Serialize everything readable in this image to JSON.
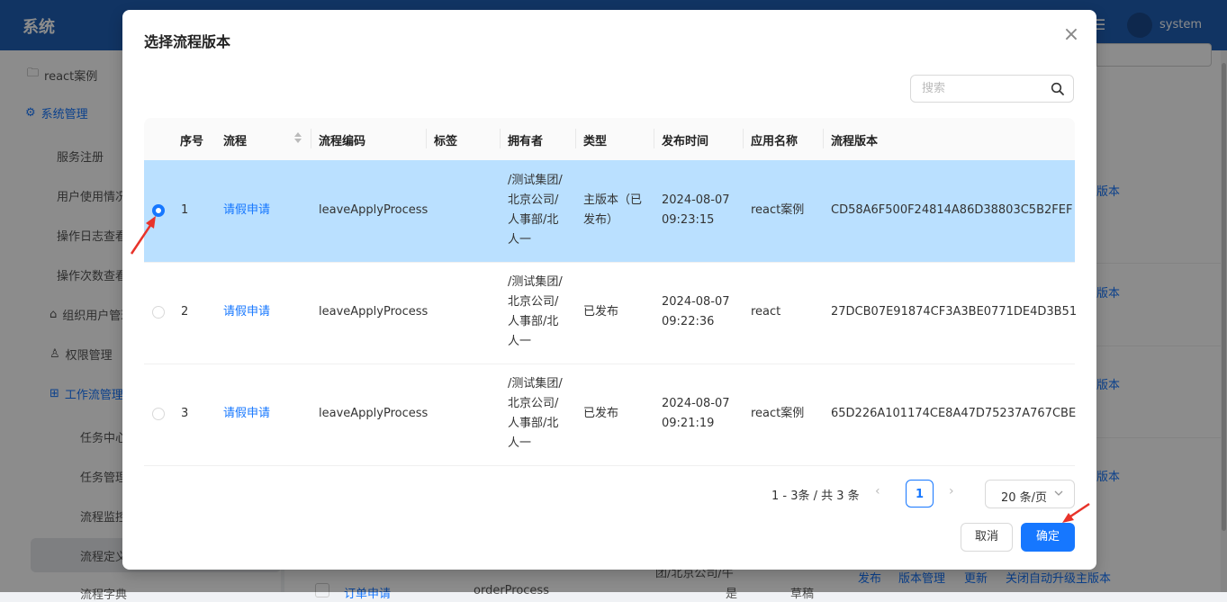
{
  "app": {
    "title": "系统",
    "user": "system"
  },
  "sidebar": {
    "items": [
      {
        "label": "react案例"
      },
      {
        "label": "系统管理"
      },
      {
        "label": "服务注册"
      },
      {
        "label": "用户使用情况"
      },
      {
        "label": "操作日志查看"
      },
      {
        "label": "操作次数查看"
      },
      {
        "label": "组织用户管理"
      },
      {
        "label": "权限管理"
      },
      {
        "label": "工作流管理"
      },
      {
        "label": "任务中心"
      },
      {
        "label": "任务管理"
      },
      {
        "label": "流程监控"
      },
      {
        "label": "流程定义"
      },
      {
        "label": "流程字典"
      }
    ]
  },
  "background": {
    "version_links": [
      "版本",
      "版本",
      "版本",
      "版本"
    ],
    "bottom_row": {
      "name": "订单申请",
      "code": "orderProcess",
      "owner": "团/北京公司/牛",
      "is_main": "是",
      "status": "草稿",
      "actions": [
        "发布",
        "版本管理",
        "更新",
        "关闭自动升级主版本"
      ]
    }
  },
  "modal": {
    "title": "选择流程版本",
    "close_label": "×",
    "search_placeholder": "搜索",
    "columns": {
      "index": "序号",
      "process": "流程",
      "code": "流程编码",
      "tag": "标签",
      "owner": "拥有者",
      "type": "类型",
      "publish_time": "发布时间",
      "app_name": "应用名称",
      "version": "流程版本"
    },
    "rows": [
      {
        "selected": true,
        "index": "1",
        "process": "请假申请",
        "code": "leaveApplyProcess",
        "tag": "",
        "owner_lines": [
          "/测试集团/",
          "北京公司/",
          "人事部/北",
          "人一"
        ],
        "type_lines": [
          "主版本（已",
          "发布）"
        ],
        "time_lines": [
          "2024-08-07",
          "09:23:15"
        ],
        "app_name": "react案例",
        "version": "CD58A6F500F24814A86D38803C5B2FEF"
      },
      {
        "selected": false,
        "index": "2",
        "process": "请假申请",
        "code": "leaveApplyProcess",
        "tag": "",
        "owner_lines": [
          "/测试集团/",
          "北京公司/",
          "人事部/北",
          "人一"
        ],
        "type_lines": [
          "已发布"
        ],
        "time_lines": [
          "2024-08-07",
          "09:22:36"
        ],
        "app_name": "react",
        "version": "27DCB07E91874CF3A3BE0771DE4D3B51"
      },
      {
        "selected": false,
        "index": "3",
        "process": "请假申请",
        "code": "leaveApplyProcess",
        "tag": "",
        "owner_lines": [
          "/测试集团/",
          "北京公司/",
          "人事部/北",
          "人一"
        ],
        "type_lines": [
          "已发布"
        ],
        "time_lines": [
          "2024-08-07",
          "09:21:19"
        ],
        "app_name": "react案例",
        "version": "65D226A101174CE8A47D75237A767CBE"
      }
    ],
    "pagination": {
      "summary": "1 - 3条 / 共 3 条",
      "prev": "‹",
      "current": "1",
      "next": "›",
      "page_size": "20 条/页"
    },
    "buttons": {
      "cancel": "取消",
      "ok": "确定"
    }
  },
  "colors": {
    "primary": "#1677ff",
    "header": "#1f5fb5",
    "selected_row": "#bae0ff",
    "annotation_arrow": "#e8332a"
  }
}
